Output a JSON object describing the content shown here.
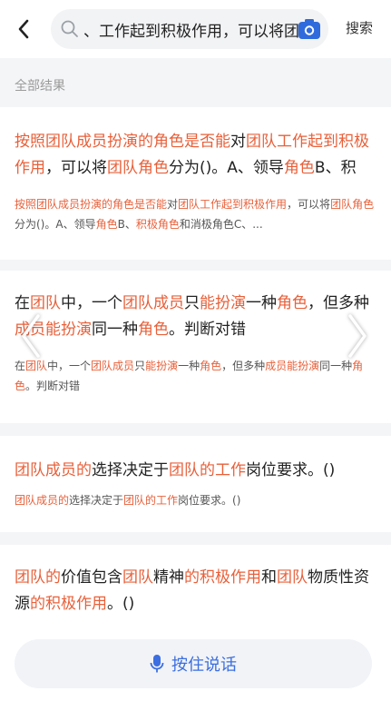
{
  "header": {
    "search_value": "、工作起到积极作用，可以将团",
    "search_button": "搜索",
    "icons": {
      "back": "chevron-left-icon",
      "search": "search-icon",
      "camera": "camera-icon"
    },
    "accent": "#2f6bdc"
  },
  "results": {
    "section_label": "全部结果",
    "highlight_color": "#e8603a",
    "cards": [
      {
        "title": [
          {
            "t": "按照团队成员扮演的角色是否能",
            "h": true
          },
          {
            "t": "对",
            "h": false
          },
          {
            "t": "团队工作起到积极作用",
            "h": true
          },
          {
            "t": "，可以将",
            "h": false
          },
          {
            "t": "团队角色",
            "h": true
          },
          {
            "t": "分为()。A、领导",
            "h": false
          },
          {
            "t": "角色",
            "h": true
          },
          {
            "t": "B、积",
            "h": false
          }
        ],
        "snippet": [
          {
            "t": "按照团队成员扮演的角色是否能",
            "h": true
          },
          {
            "t": "对",
            "h": false
          },
          {
            "t": "团队工作起到积极作用",
            "h": true
          },
          {
            "t": "，可以将",
            "h": false
          },
          {
            "t": "团队角色",
            "h": true
          },
          {
            "t": "分为()。A、领导",
            "h": false
          },
          {
            "t": "角色",
            "h": true
          },
          {
            "t": "B、",
            "h": false
          },
          {
            "t": "积极角色",
            "h": true
          },
          {
            "t": "和消极角色C、...",
            "h": false
          }
        ]
      },
      {
        "title": [
          {
            "t": "在",
            "h": false
          },
          {
            "t": "团队",
            "h": true
          },
          {
            "t": "中，一个",
            "h": false
          },
          {
            "t": "团队成员",
            "h": true
          },
          {
            "t": "只",
            "h": false
          },
          {
            "t": "能扮演",
            "h": true
          },
          {
            "t": "一种",
            "h": false
          },
          {
            "t": "角色",
            "h": true
          },
          {
            "t": "，但多种",
            "h": false
          },
          {
            "t": "成员能扮演",
            "h": true
          },
          {
            "t": "同一种",
            "h": false
          },
          {
            "t": "角色",
            "h": true
          },
          {
            "t": "。判断对错",
            "h": false
          }
        ],
        "snippet": [
          {
            "t": "在",
            "h": false
          },
          {
            "t": "团队",
            "h": true
          },
          {
            "t": "中，一个",
            "h": false
          },
          {
            "t": "团队成员",
            "h": true
          },
          {
            "t": "只",
            "h": false
          },
          {
            "t": "能扮演",
            "h": true
          },
          {
            "t": "一种",
            "h": false
          },
          {
            "t": "角色",
            "h": true
          },
          {
            "t": "，但多种",
            "h": false
          },
          {
            "t": "成员能扮演",
            "h": true
          },
          {
            "t": "同一种",
            "h": false
          },
          {
            "t": "角色",
            "h": true
          },
          {
            "t": "。判断对错",
            "h": false
          }
        ]
      },
      {
        "title": [
          {
            "t": "团队成员的",
            "h": true
          },
          {
            "t": "选择决定于",
            "h": false
          },
          {
            "t": "团队的工作",
            "h": true
          },
          {
            "t": "岗位要求。()",
            "h": false
          }
        ],
        "snippet": [
          {
            "t": "团队成员的",
            "h": true
          },
          {
            "t": "选择决定于",
            "h": false
          },
          {
            "t": "团队的工作",
            "h": true
          },
          {
            "t": "岗位要求。()",
            "h": false
          }
        ]
      },
      {
        "title": [
          {
            "t": "团队的",
            "h": true
          },
          {
            "t": "价值包含",
            "h": false
          },
          {
            "t": "团队",
            "h": true
          },
          {
            "t": "精神",
            "h": false
          },
          {
            "t": "的积极作用",
            "h": true
          },
          {
            "t": "和",
            "h": false
          },
          {
            "t": "团队",
            "h": true
          },
          {
            "t": "物质性资源",
            "h": false
          },
          {
            "t": "的积极作用",
            "h": true
          },
          {
            "t": "。()",
            "h": false
          }
        ],
        "snippet": []
      }
    ]
  },
  "nav": {
    "prev_icon": "chevron-left-icon",
    "next_icon": "chevron-right-icon"
  },
  "voice": {
    "label": "按住说话",
    "icon": "microphone-icon"
  }
}
